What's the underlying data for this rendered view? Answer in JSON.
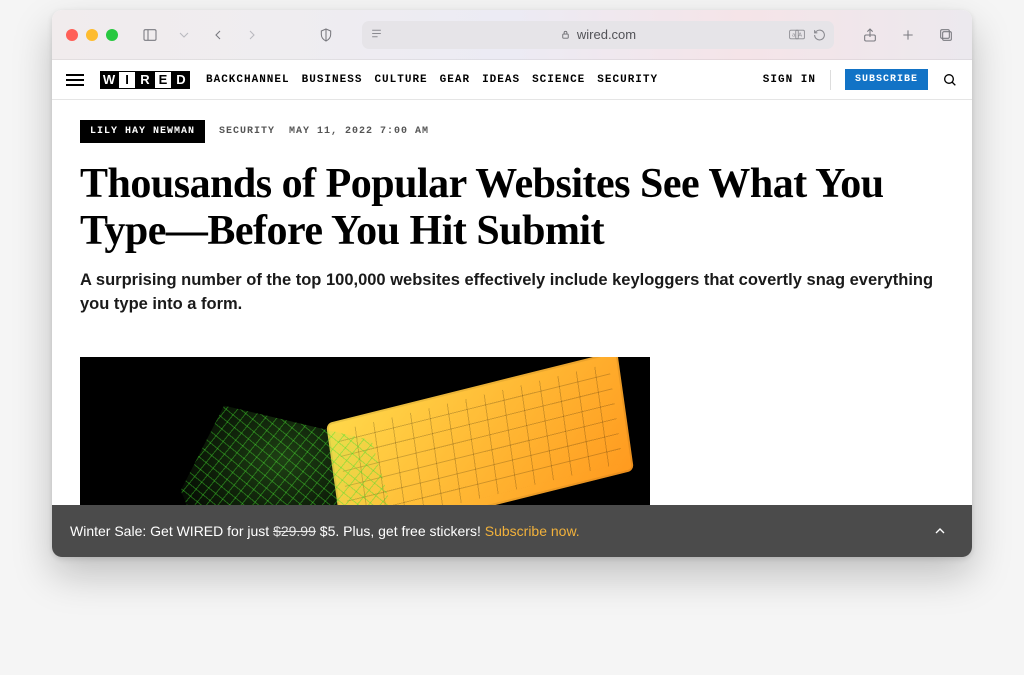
{
  "browser": {
    "domain": "wired.com"
  },
  "header": {
    "logo_letters": [
      "W",
      "I",
      "R",
      "E",
      "D"
    ],
    "nav": [
      "BACKCHANNEL",
      "BUSINESS",
      "CULTURE",
      "GEAR",
      "IDEAS",
      "SCIENCE",
      "SECURITY"
    ],
    "sign_in": "SIGN IN",
    "subscribe": "SUBSCRIBE"
  },
  "article": {
    "author": "LILY HAY NEWMAN",
    "category": "SECURITY",
    "timestamp": "MAY 11, 2022 7:00 AM",
    "headline": "Thousands of Popular Websites See What You Type—Before You Hit Submit",
    "dek": "A surprising number of the top 100,000 websites effectively include keyloggers that covertly snag everything you type into a form."
  },
  "promo": {
    "lead": "Winter Sale: Get WIRED for just ",
    "strike_price": "$29.99",
    "price": " $5. Plus, get free stickers! ",
    "cta": "Subscribe now."
  }
}
